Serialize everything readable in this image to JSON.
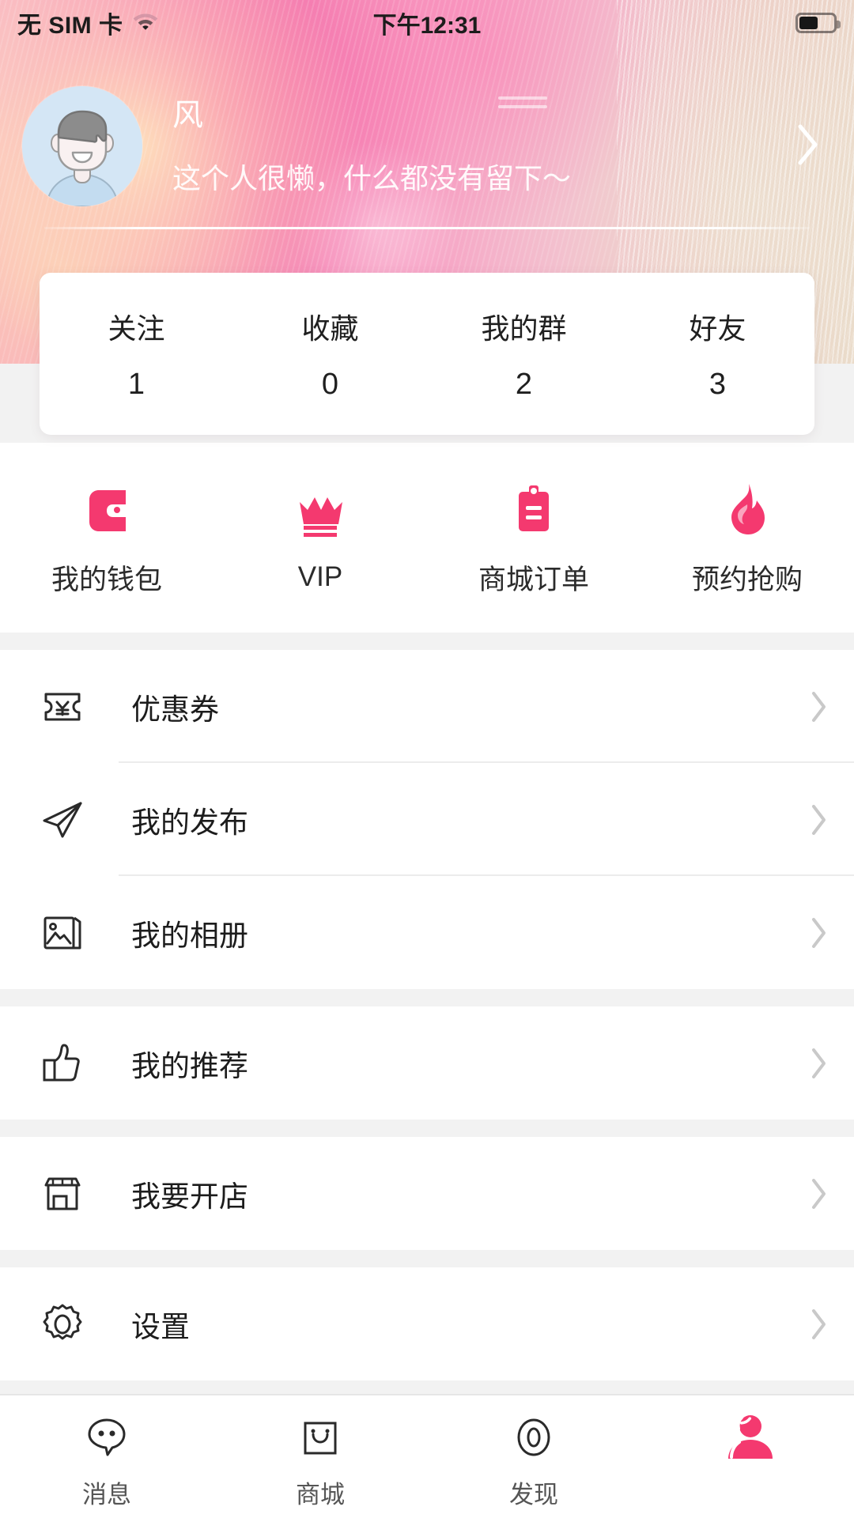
{
  "theme": {
    "accent": "#f4396f",
    "page_bg": "#f2f2f2",
    "card_bg": "#ffffff",
    "text": "#1c1c1c"
  },
  "status_bar": {
    "carrier": "无 SIM 卡",
    "wifi_icon": "wifi-icon",
    "time": "下午12:31",
    "battery_icon": "battery-icon",
    "battery_level": 55
  },
  "header": {
    "avatar_icon": "avatar",
    "name": "风",
    "bio": "这个人很懒，什么都没有留下～",
    "chevron_icon": "chevron-right-icon",
    "decoration_icon": "double-line-decoration"
  },
  "stats": [
    {
      "label": "关注",
      "value": "1"
    },
    {
      "label": "收藏",
      "value": "0"
    },
    {
      "label": "我的群",
      "value": "2"
    },
    {
      "label": "好友",
      "value": "3"
    }
  ],
  "quick_actions": [
    {
      "label": "我的钱包",
      "icon": "wallet-icon"
    },
    {
      "label": "VIP",
      "icon": "crown-icon"
    },
    {
      "label": "商城订单",
      "icon": "clipboard-icon"
    },
    {
      "label": "预约抢购",
      "icon": "flame-icon"
    }
  ],
  "menu_groups": [
    {
      "items": [
        {
          "label": "优惠券",
          "icon": "coupon-icon"
        },
        {
          "label": "我的发布",
          "icon": "paper-plane-icon"
        },
        {
          "label": "我的相册",
          "icon": "photo-album-icon"
        }
      ]
    },
    {
      "items": [
        {
          "label": "我的推荐",
          "icon": "thumbs-up-icon"
        }
      ]
    },
    {
      "items": [
        {
          "label": "我要开店",
          "icon": "storefront-icon"
        }
      ]
    },
    {
      "items": [
        {
          "label": "设置",
          "icon": "gear-icon"
        }
      ]
    }
  ],
  "tab_bar": [
    {
      "label": "消息",
      "icon": "chat-bubble-icon",
      "active": false
    },
    {
      "label": "商城",
      "icon": "shopping-bag-icon",
      "active": false
    },
    {
      "label": "发现",
      "icon": "eye-icon",
      "active": false
    },
    {
      "label": "",
      "icon": "person-icon",
      "active": true
    }
  ]
}
